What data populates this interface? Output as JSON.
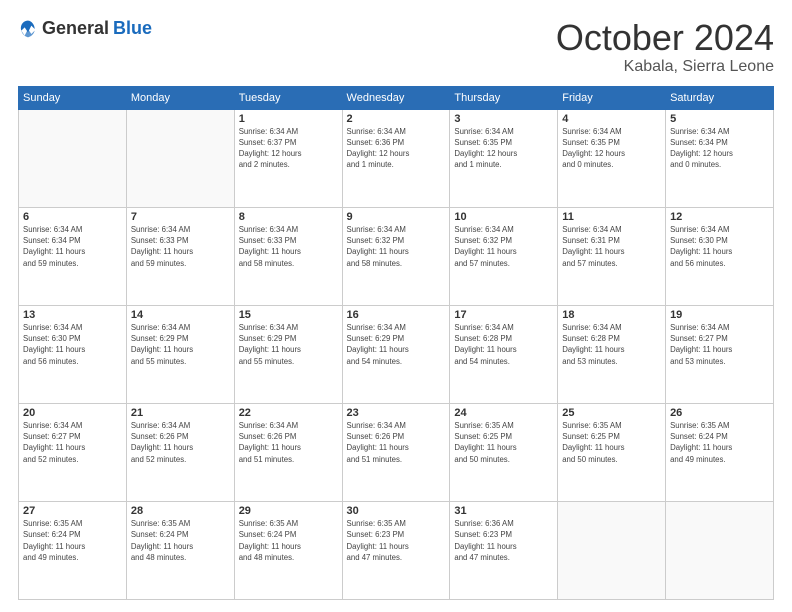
{
  "logo": {
    "general": "General",
    "blue": "Blue"
  },
  "header": {
    "month": "October 2024",
    "location": "Kabala, Sierra Leone"
  },
  "weekdays": [
    "Sunday",
    "Monday",
    "Tuesday",
    "Wednesday",
    "Thursday",
    "Friday",
    "Saturday"
  ],
  "weeks": [
    [
      {
        "day": "",
        "info": ""
      },
      {
        "day": "",
        "info": ""
      },
      {
        "day": "1",
        "info": "Sunrise: 6:34 AM\nSunset: 6:37 PM\nDaylight: 12 hours\nand 2 minutes."
      },
      {
        "day": "2",
        "info": "Sunrise: 6:34 AM\nSunset: 6:36 PM\nDaylight: 12 hours\nand 1 minute."
      },
      {
        "day": "3",
        "info": "Sunrise: 6:34 AM\nSunset: 6:35 PM\nDaylight: 12 hours\nand 1 minute."
      },
      {
        "day": "4",
        "info": "Sunrise: 6:34 AM\nSunset: 6:35 PM\nDaylight: 12 hours\nand 0 minutes."
      },
      {
        "day": "5",
        "info": "Sunrise: 6:34 AM\nSunset: 6:34 PM\nDaylight: 12 hours\nand 0 minutes."
      }
    ],
    [
      {
        "day": "6",
        "info": "Sunrise: 6:34 AM\nSunset: 6:34 PM\nDaylight: 11 hours\nand 59 minutes."
      },
      {
        "day": "7",
        "info": "Sunrise: 6:34 AM\nSunset: 6:33 PM\nDaylight: 11 hours\nand 59 minutes."
      },
      {
        "day": "8",
        "info": "Sunrise: 6:34 AM\nSunset: 6:33 PM\nDaylight: 11 hours\nand 58 minutes."
      },
      {
        "day": "9",
        "info": "Sunrise: 6:34 AM\nSunset: 6:32 PM\nDaylight: 11 hours\nand 58 minutes."
      },
      {
        "day": "10",
        "info": "Sunrise: 6:34 AM\nSunset: 6:32 PM\nDaylight: 11 hours\nand 57 minutes."
      },
      {
        "day": "11",
        "info": "Sunrise: 6:34 AM\nSunset: 6:31 PM\nDaylight: 11 hours\nand 57 minutes."
      },
      {
        "day": "12",
        "info": "Sunrise: 6:34 AM\nSunset: 6:30 PM\nDaylight: 11 hours\nand 56 minutes."
      }
    ],
    [
      {
        "day": "13",
        "info": "Sunrise: 6:34 AM\nSunset: 6:30 PM\nDaylight: 11 hours\nand 56 minutes."
      },
      {
        "day": "14",
        "info": "Sunrise: 6:34 AM\nSunset: 6:29 PM\nDaylight: 11 hours\nand 55 minutes."
      },
      {
        "day": "15",
        "info": "Sunrise: 6:34 AM\nSunset: 6:29 PM\nDaylight: 11 hours\nand 55 minutes."
      },
      {
        "day": "16",
        "info": "Sunrise: 6:34 AM\nSunset: 6:29 PM\nDaylight: 11 hours\nand 54 minutes."
      },
      {
        "day": "17",
        "info": "Sunrise: 6:34 AM\nSunset: 6:28 PM\nDaylight: 11 hours\nand 54 minutes."
      },
      {
        "day": "18",
        "info": "Sunrise: 6:34 AM\nSunset: 6:28 PM\nDaylight: 11 hours\nand 53 minutes."
      },
      {
        "day": "19",
        "info": "Sunrise: 6:34 AM\nSunset: 6:27 PM\nDaylight: 11 hours\nand 53 minutes."
      }
    ],
    [
      {
        "day": "20",
        "info": "Sunrise: 6:34 AM\nSunset: 6:27 PM\nDaylight: 11 hours\nand 52 minutes."
      },
      {
        "day": "21",
        "info": "Sunrise: 6:34 AM\nSunset: 6:26 PM\nDaylight: 11 hours\nand 52 minutes."
      },
      {
        "day": "22",
        "info": "Sunrise: 6:34 AM\nSunset: 6:26 PM\nDaylight: 11 hours\nand 51 minutes."
      },
      {
        "day": "23",
        "info": "Sunrise: 6:34 AM\nSunset: 6:26 PM\nDaylight: 11 hours\nand 51 minutes."
      },
      {
        "day": "24",
        "info": "Sunrise: 6:35 AM\nSunset: 6:25 PM\nDaylight: 11 hours\nand 50 minutes."
      },
      {
        "day": "25",
        "info": "Sunrise: 6:35 AM\nSunset: 6:25 PM\nDaylight: 11 hours\nand 50 minutes."
      },
      {
        "day": "26",
        "info": "Sunrise: 6:35 AM\nSunset: 6:24 PM\nDaylight: 11 hours\nand 49 minutes."
      }
    ],
    [
      {
        "day": "27",
        "info": "Sunrise: 6:35 AM\nSunset: 6:24 PM\nDaylight: 11 hours\nand 49 minutes."
      },
      {
        "day": "28",
        "info": "Sunrise: 6:35 AM\nSunset: 6:24 PM\nDaylight: 11 hours\nand 48 minutes."
      },
      {
        "day": "29",
        "info": "Sunrise: 6:35 AM\nSunset: 6:24 PM\nDaylight: 11 hours\nand 48 minutes."
      },
      {
        "day": "30",
        "info": "Sunrise: 6:35 AM\nSunset: 6:23 PM\nDaylight: 11 hours\nand 47 minutes."
      },
      {
        "day": "31",
        "info": "Sunrise: 6:36 AM\nSunset: 6:23 PM\nDaylight: 11 hours\nand 47 minutes."
      },
      {
        "day": "",
        "info": ""
      },
      {
        "day": "",
        "info": ""
      }
    ]
  ]
}
